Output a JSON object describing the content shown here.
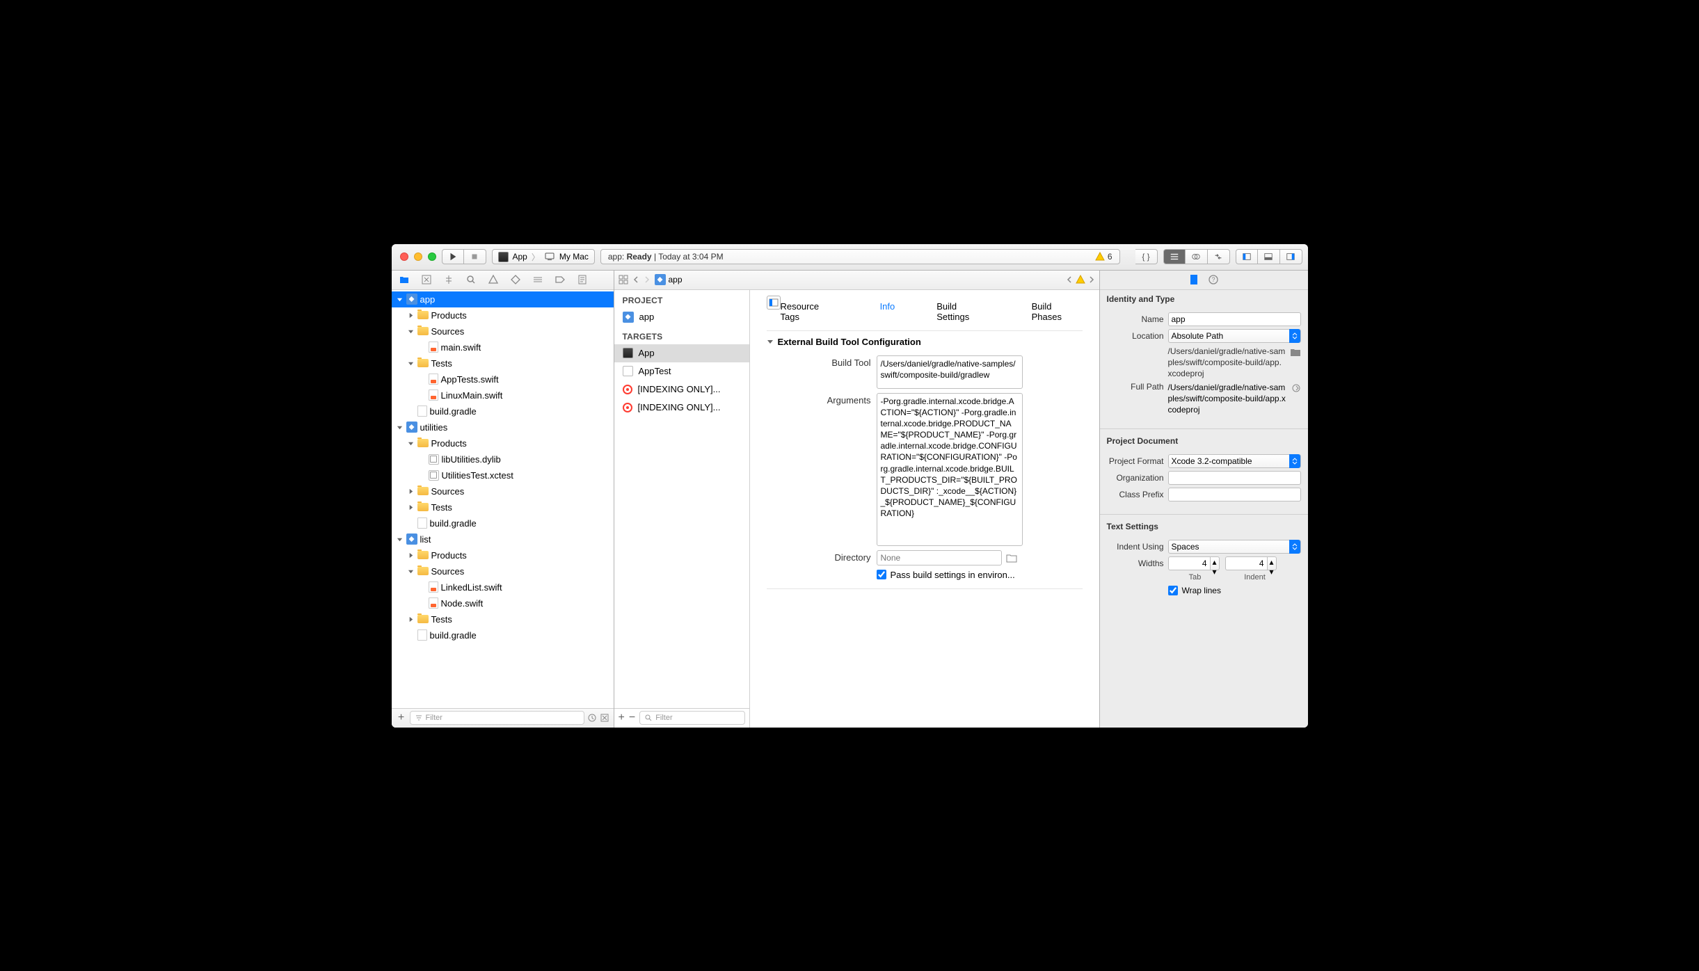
{
  "toolbar": {
    "scheme_target": "App",
    "scheme_device": "My Mac",
    "status_prefix": "app:",
    "status_main": "Ready",
    "status_time": "Today at 3:04 PM",
    "issue_count": "6"
  },
  "navigator": {
    "filter_placeholder": "Filter",
    "items": [
      {
        "depth": 0,
        "name": "app",
        "icon": "project",
        "disclosure": "open",
        "selected": true
      },
      {
        "depth": 1,
        "name": "Products",
        "icon": "folder",
        "disclosure": "closed"
      },
      {
        "depth": 1,
        "name": "Sources",
        "icon": "folder",
        "disclosure": "open"
      },
      {
        "depth": 2,
        "name": "main.swift",
        "icon": "swift"
      },
      {
        "depth": 1,
        "name": "Tests",
        "icon": "folder",
        "disclosure": "open"
      },
      {
        "depth": 2,
        "name": "AppTests.swift",
        "icon": "swift"
      },
      {
        "depth": 2,
        "name": "LinuxMain.swift",
        "icon": "swift"
      },
      {
        "depth": 1,
        "name": "build.gradle",
        "icon": "file"
      },
      {
        "depth": 0,
        "name": "utilities",
        "icon": "project",
        "disclosure": "open"
      },
      {
        "depth": 1,
        "name": "Products",
        "icon": "folder",
        "disclosure": "open"
      },
      {
        "depth": 2,
        "name": "libUtilities.dylib",
        "icon": "product"
      },
      {
        "depth": 2,
        "name": "UtilitiesTest.xctest",
        "icon": "product"
      },
      {
        "depth": 1,
        "name": "Sources",
        "icon": "folder",
        "disclosure": "closed"
      },
      {
        "depth": 1,
        "name": "Tests",
        "icon": "folder",
        "disclosure": "closed"
      },
      {
        "depth": 1,
        "name": "build.gradle",
        "icon": "file"
      },
      {
        "depth": 0,
        "name": "list",
        "icon": "project",
        "disclosure": "open"
      },
      {
        "depth": 1,
        "name": "Products",
        "icon": "folder",
        "disclosure": "closed"
      },
      {
        "depth": 1,
        "name": "Sources",
        "icon": "folder",
        "disclosure": "open"
      },
      {
        "depth": 2,
        "name": "LinkedList.swift",
        "icon": "swift"
      },
      {
        "depth": 2,
        "name": "Node.swift",
        "icon": "swift"
      },
      {
        "depth": 1,
        "name": "Tests",
        "icon": "folder",
        "disclosure": "closed"
      },
      {
        "depth": 1,
        "name": "build.gradle",
        "icon": "file"
      }
    ]
  },
  "jump_bar": {
    "crumb": "app"
  },
  "editor": {
    "tabs": [
      "Resource Tags",
      "Info",
      "Build Settings",
      "Build Phases"
    ],
    "active_tab": "Info",
    "project_header": "PROJECT",
    "project_items": [
      "app"
    ],
    "targets_header": "TARGETS",
    "targets": [
      {
        "name": "App",
        "icon": "exec",
        "selected": true
      },
      {
        "name": "AppTest",
        "icon": "lib"
      },
      {
        "name": "[INDEXING ONLY]...",
        "icon": "bullseye"
      },
      {
        "name": "[INDEXING ONLY]...",
        "icon": "bullseye"
      }
    ],
    "filter_placeholder": "Filter",
    "section_title": "External Build Tool Configuration",
    "build_tool_label": "Build Tool",
    "build_tool_value": "/Users/daniel/gradle/native-samples/swift/composite-build/gradlew",
    "arguments_label": "Arguments",
    "arguments_value": "-Porg.gradle.internal.xcode.bridge.ACTION=\"${ACTION}\" -Porg.gradle.internal.xcode.bridge.PRODUCT_NAME=\"${PRODUCT_NAME}\" -Porg.gradle.internal.xcode.bridge.CONFIGURATION=\"${CONFIGURATION}\" -Porg.gradle.internal.xcode.bridge.BUILT_PRODUCTS_DIR=\"${BUILT_PRODUCTS_DIR}\" :_xcode__${ACTION}_${PRODUCT_NAME}_${CONFIGURATION}",
    "directory_label": "Directory",
    "directory_placeholder": "None",
    "pass_env_label": "Pass build settings in environ...",
    "pass_env_checked": true
  },
  "inspector": {
    "identity_title": "Identity and Type",
    "name_label": "Name",
    "name_value": "app",
    "location_label": "Location",
    "location_value": "Absolute Path",
    "location_path": "/Users/daniel/gradle/native-samples/swift/composite-build/app.xcodeproj",
    "full_path_label": "Full Path",
    "full_path_value": "/Users/daniel/gradle/native-samples/swift/composite-build/app.xcodeproj",
    "proj_doc_title": "Project Document",
    "proj_format_label": "Project Format",
    "proj_format_value": "Xcode 3.2-compatible",
    "organization_label": "Organization",
    "organization_value": "",
    "class_prefix_label": "Class Prefix",
    "class_prefix_value": "",
    "text_settings_title": "Text Settings",
    "indent_using_label": "Indent Using",
    "indent_using_value": "Spaces",
    "widths_label": "Widths",
    "tab_width": "4",
    "indent_width": "4",
    "tab_label": "Tab",
    "indent_label": "Indent",
    "wrap_lines_label": "Wrap lines",
    "wrap_lines_checked": true
  }
}
